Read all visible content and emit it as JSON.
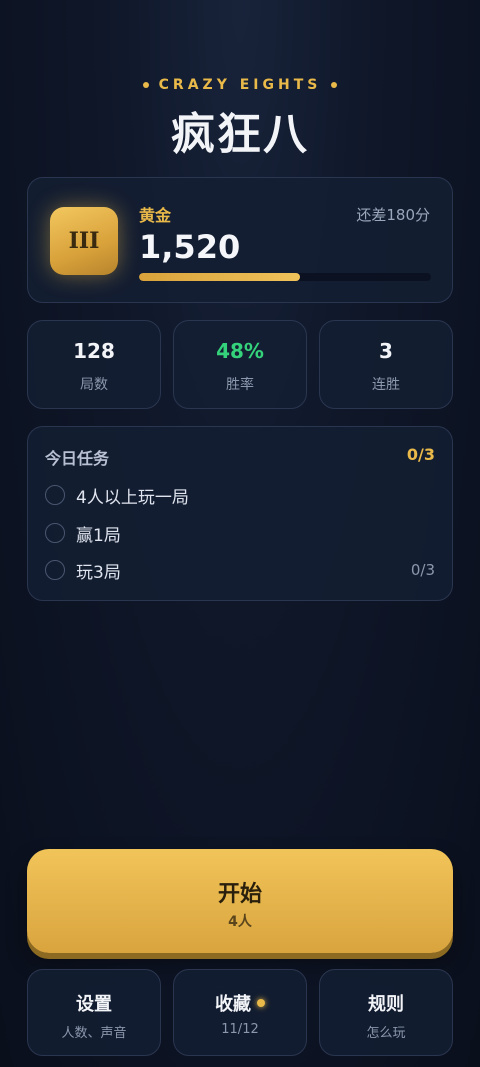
{
  "header": {
    "subtitle": "CRAZY EIGHTS",
    "title": "疯狂八"
  },
  "rank": {
    "badge": "III",
    "tier": "黄金",
    "points": "1,520",
    "remaining": "还差180分",
    "progress": 0.55,
    "accent": "#e9b949"
  },
  "stats": [
    {
      "value": "128",
      "label": "局数"
    },
    {
      "value": "48%",
      "label": "胜率",
      "color": "#34d27a"
    },
    {
      "value": "3",
      "label": "连胜"
    }
  ],
  "tasks": {
    "title": "今日任务",
    "count": "0/3",
    "items": [
      {
        "text": "4人以上玩一局",
        "progress": ""
      },
      {
        "text": "赢1局",
        "progress": ""
      },
      {
        "text": "玩3局",
        "progress": "0/3"
      }
    ]
  },
  "start": {
    "label": "开始",
    "players": "4人"
  },
  "bottom": [
    {
      "label": "设置",
      "sub": "人数、声音"
    },
    {
      "label": "收藏",
      "sub": "11/12",
      "notification": true
    },
    {
      "label": "规则",
      "sub": "怎么玩"
    }
  ]
}
